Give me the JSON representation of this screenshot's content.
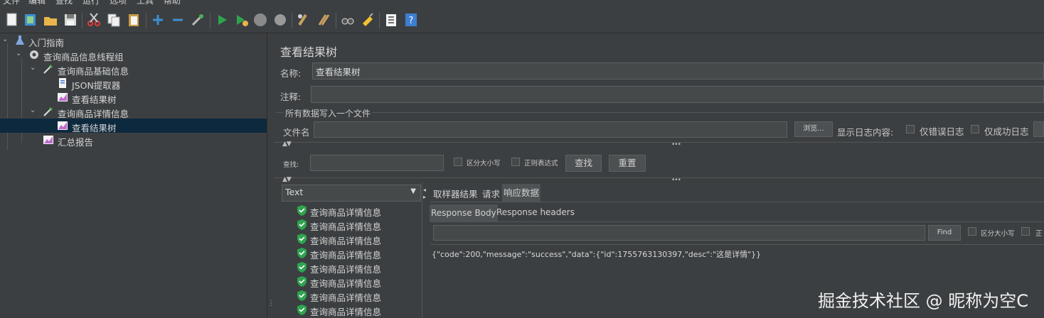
{
  "menu": [
    "文件",
    "编辑",
    "查找",
    "运行",
    "选项",
    "工具",
    "帮助"
  ],
  "toolbar": {
    "icons": [
      "new-icon",
      "templates-icon",
      "open-icon",
      "save-icon",
      "cut-icon",
      "copy-icon",
      "paste-icon",
      "expand-icon",
      "collapse-icon",
      "toggle-icon",
      "start-icon",
      "start-no-pause-icon",
      "stop-icon",
      "shutdown-icon",
      "clear-icon",
      "clear-all-icon",
      "search-icon",
      "reset-search-icon",
      "function-helper-icon",
      "help-icon"
    ]
  },
  "tree": {
    "items": [
      {
        "label": "入门指南"
      },
      {
        "label": "查询商品信息线程组"
      },
      {
        "label": "查询商品基础信息"
      },
      {
        "label": "JSON提取器"
      },
      {
        "label": "查看结果树"
      },
      {
        "label": "查询商品详情信息"
      },
      {
        "label": "查看结果树"
      },
      {
        "label": "汇总报告"
      }
    ]
  },
  "panel": {
    "title": "查看结果树",
    "name_label": "名称:",
    "name_value": "查看结果树",
    "comment_label": "注释:",
    "comment_value": "",
    "file_group_label": "所有数据写入一个文件",
    "filename_label": "文件名",
    "filename_value": "",
    "browse_label": "浏览...",
    "log_label": "显示日志内容:",
    "errors_only_label": "仅错误日志",
    "success_only_label": "仅成功日志"
  },
  "search": {
    "label": "查找:",
    "value": "",
    "case_label": "区分大小写",
    "regex_label": "正则表达式",
    "find_button": "查找",
    "reset_button": "重置"
  },
  "results": {
    "renderer": "Text",
    "samples": [
      "查询商品详情信息",
      "查询商品详情信息",
      "查询商品详情信息",
      "查询商品详情信息",
      "查询商品详情信息",
      "查询商品详情信息",
      "查询商品详情信息",
      "查询商品详情信息"
    ],
    "tabs": [
      "取样器结果",
      "请求",
      "响应数据"
    ],
    "subtabs": [
      "Response Body",
      "Response headers"
    ],
    "find_button": "Find",
    "case_label": "区分大小写",
    "regex_label_partial": "正",
    "response_body": "{\"code\":200,\"message\":\"success\",\"data\":{\"id\":1755763130397,\"desc\":\"这是详情\"}}"
  },
  "watermark": "掘金技术社区 @ 昵称为空C",
  "colors": {
    "background": "#3c3f41",
    "selection": "#0d293e",
    "success_green": "#2ea44f"
  }
}
